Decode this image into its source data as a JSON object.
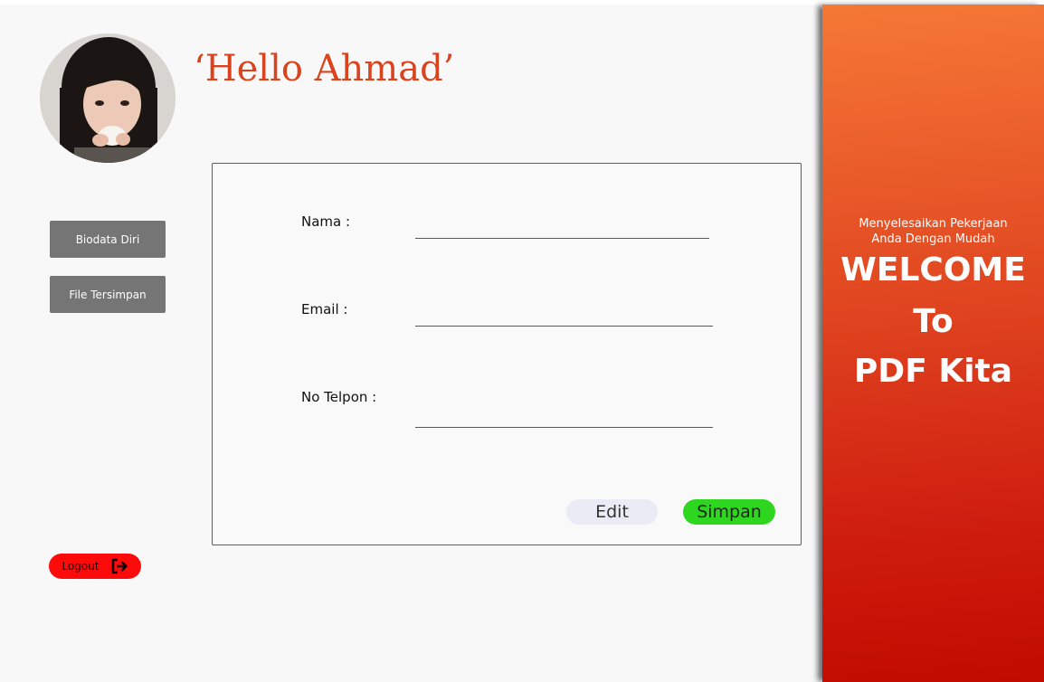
{
  "greeting": "‘Hello Ahmad’",
  "profile": {
    "avatar_icon": "user-photo"
  },
  "sidebar": {
    "items": [
      {
        "label": "Biodata Diri"
      },
      {
        "label": "File Tersimpan"
      }
    ],
    "logout": {
      "label": "Logout",
      "icon": "logout-icon"
    }
  },
  "form": {
    "fields": [
      {
        "label": "Nama :",
        "value": ""
      },
      {
        "label": "Email :",
        "value": ""
      },
      {
        "label": "No Telpon :",
        "value": ""
      }
    ],
    "edit_label": "Edit",
    "save_label": "Simpan"
  },
  "welcome_panel": {
    "tagline_line1": "Menyelesaikan Pekerjaan",
    "tagline_line2": "Anda Dengan Mudah",
    "title_line1": "WELCOME",
    "title_line2": "To",
    "title_line3": "PDF Kita"
  },
  "colors": {
    "greeting": "#d9441f",
    "nav_button": "#757575",
    "save_button": "#2fd620",
    "edit_button": "#ebebf5",
    "logout_button": "#ff0a0a",
    "panel_top": "#f57836",
    "panel_bottom": "#c10a00"
  }
}
